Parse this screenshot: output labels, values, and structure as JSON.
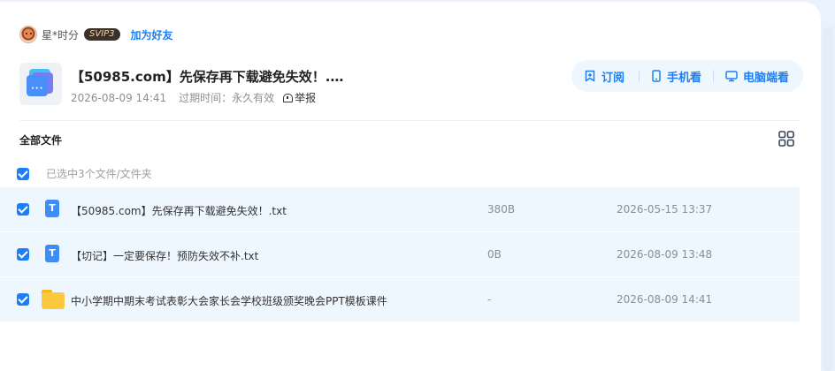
{
  "sharer": {
    "name": "星*时分",
    "vip_badge": "SVIP3",
    "add_friend": "加为好友"
  },
  "share": {
    "title": "【50985.com】先保存再下载避免失效！.…",
    "date": "2026-08-09 14:41",
    "expire": "过期时间：永久有效",
    "report": "举报"
  },
  "actions": {
    "subscribe": "订阅",
    "mobile": "手机看",
    "desktop": "电脑端看"
  },
  "files_header": {
    "title": "全部文件",
    "view_icon": "grid-view-icon"
  },
  "selection": {
    "label": "已选中3个文件/文件夹"
  },
  "files": [
    {
      "type": "txt",
      "icon_letter": "T",
      "name": "【50985.com】先保存再下载避免失效！.txt",
      "size": "380B",
      "date": "2026-05-15 13:37"
    },
    {
      "type": "txt",
      "icon_letter": "T",
      "name": "【切记】一定要保存！预防失效不补.txt",
      "size": "0B",
      "date": "2026-08-09 13:48"
    },
    {
      "type": "folder",
      "icon_letter": "",
      "name": "中小学期中期末考试表彰大会家长会学校班级颁奖晚会PPT模板课件",
      "size": "-",
      "date": "2026-08-09 14:41"
    }
  ],
  "colors": {
    "accent": "#1f7ff2",
    "row_selected": "#eef6fe",
    "page_bg": "#eaf3fd"
  }
}
